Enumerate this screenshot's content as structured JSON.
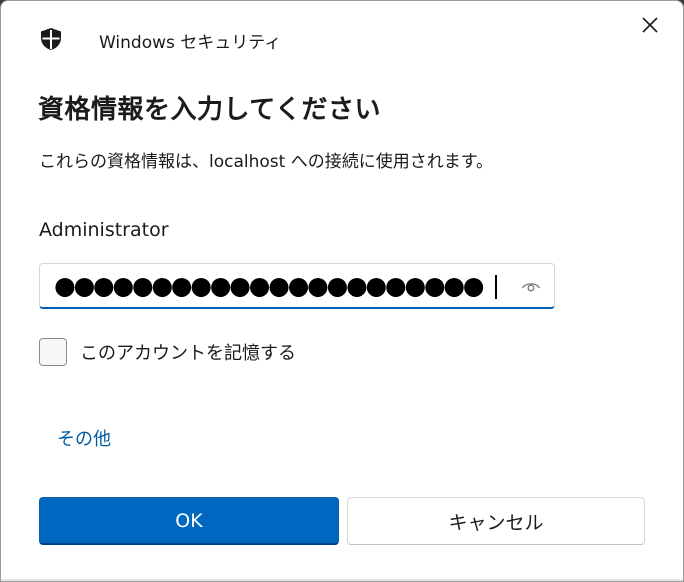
{
  "window": {
    "title": "Windows セキュリティ",
    "icon": "shield-icon",
    "close_icon": "close-icon"
  },
  "dialog": {
    "heading": "資格情報を入力してください",
    "description": "これらの資格情報は、localhost への接続に使用されます。",
    "username": "Administrator",
    "password_masked": "●●●●●●●●●●●●●●●●●●●●●●",
    "password_reveal_icon": "eye-icon",
    "remember_label": "このアカウントを記憶する",
    "remember_checked": false,
    "more_choices_link": "その他"
  },
  "buttons": {
    "ok_label": "OK",
    "cancel_label": "キャンセル"
  },
  "colors": {
    "accent": "#0067c0",
    "link": "#005a9e",
    "focus_underline": "#005fb8"
  }
}
